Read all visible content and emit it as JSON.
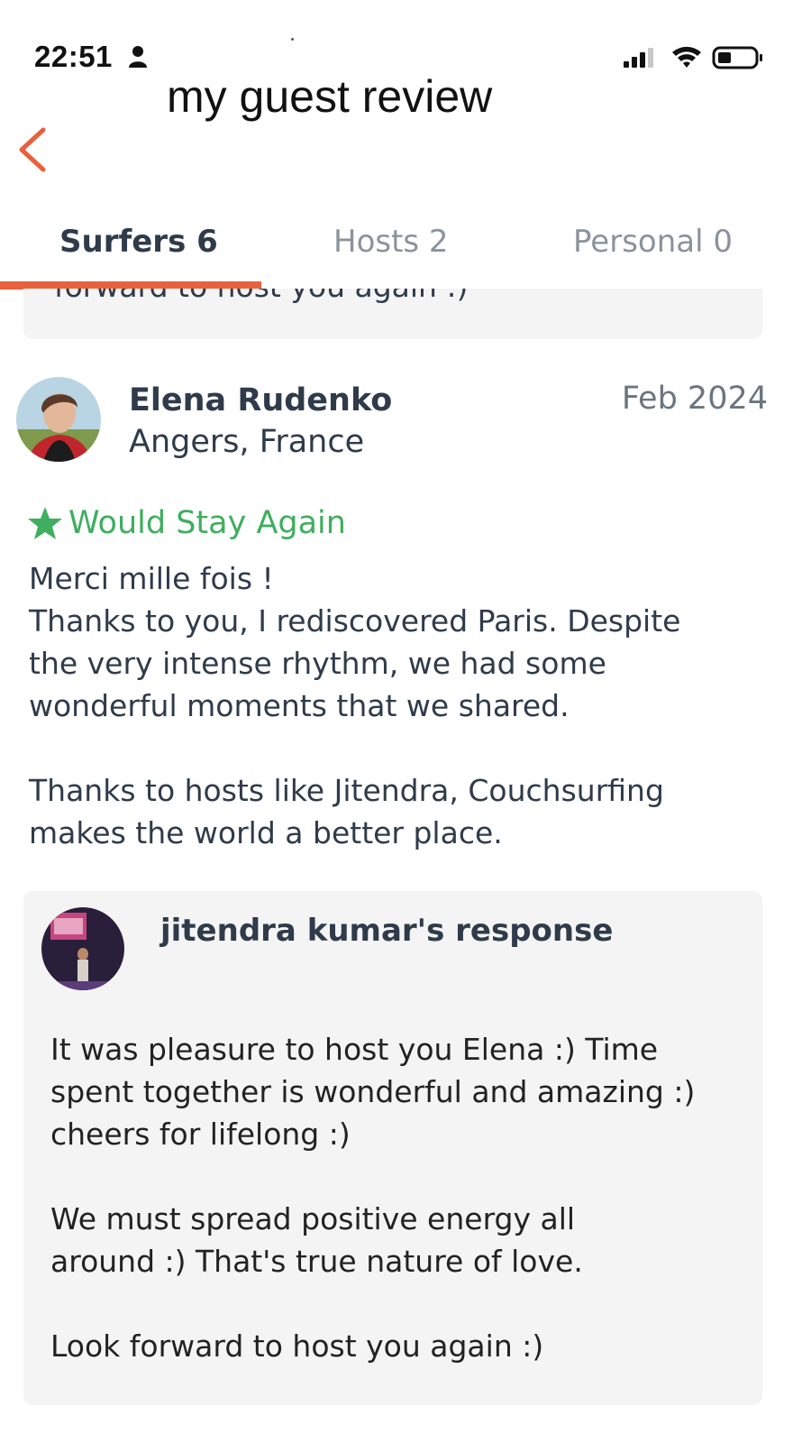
{
  "status_bar": {
    "time": "22:51",
    "icons": [
      "person-icon",
      "signal-icon",
      "wifi-icon",
      "battery-icon"
    ]
  },
  "header": {
    "title": "my guest review",
    "back_icon": "chevron-left-icon"
  },
  "tabs": [
    {
      "label": "Surfers 6",
      "active": true
    },
    {
      "label": "Hosts 2",
      "active": false
    },
    {
      "label": "Personal 0",
      "active": false
    }
  ],
  "previous_review": {
    "tail_text": "forward to host you again :)"
  },
  "review": {
    "name": "Elena Rudenko",
    "location": "Angers, France",
    "date": "Feb 2024",
    "recommendation": "Would Stay Again",
    "paragraphs": [
      "Merci mille fois !",
      "Thanks to you, I rediscovered Paris. Despite",
      "the very intense rhythm, we had some",
      "wonderful moments that we shared.",
      "Thanks to hosts like Jitendra, Couchsurfing",
      "makes the world a better place."
    ]
  },
  "response": {
    "title": "jitendra kumar's response",
    "lines": [
      "It was pleasure to host you Elena :)  Time",
      "spent together is wonderful and amazing :)",
      "cheers for lifelong :)",
      "We must spread positive energy all",
      "around :) That's true nature of love.",
      "Look forward to host you again :)"
    ]
  },
  "colors": {
    "accent": "#e8603c",
    "green": "#3fae5f",
    "text": "#2f3b4a",
    "muted": "#8a939c",
    "card_bg": "#f4f4f4"
  }
}
